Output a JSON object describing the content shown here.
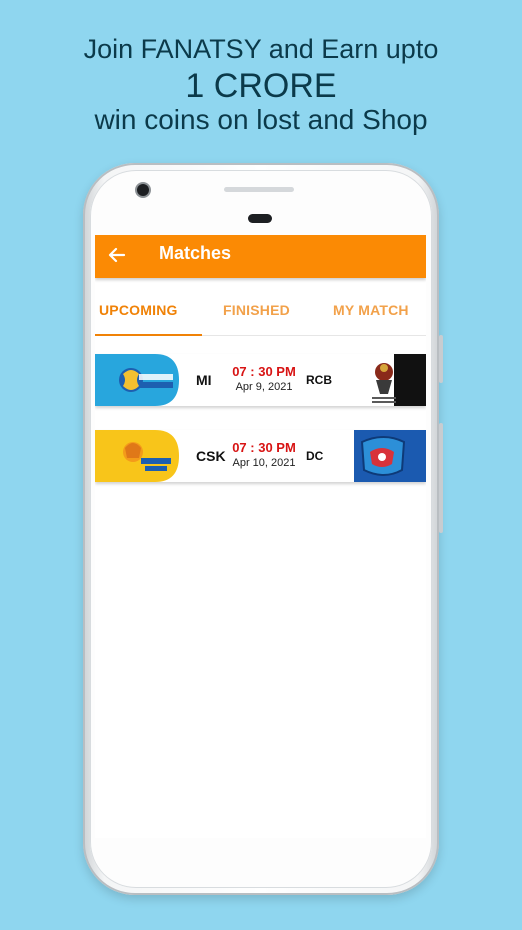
{
  "promo": {
    "line1": "Join FANATSY and Earn upto",
    "line2": "1 CRORE",
    "line3": "win coins on lost and Shop"
  },
  "app": {
    "title": "Matches",
    "tabs": [
      {
        "label": "UPCOMING",
        "active": true
      },
      {
        "label": "FINISHED",
        "active": false
      },
      {
        "label": "MY MATCH",
        "active": false
      }
    ],
    "matches": [
      {
        "team1": "MI",
        "team1_logo": "mumbai-indians-logo",
        "time": "07 : 30 PM",
        "date": "Apr 9, 2021",
        "team2": "RCB",
        "team2_logo": "royal-challengers-logo"
      },
      {
        "team1": "CSK",
        "team1_logo": "chennai-super-kings-logo",
        "time": "07 : 30 PM",
        "date": "Apr 10, 2021",
        "team2": "DC",
        "team2_logo": "delhi-capitals-logo"
      }
    ]
  },
  "colors": {
    "background": "#8fd6ef",
    "appbar": "#fb8a04",
    "tab_active": "#f08207",
    "time_text": "#d81414"
  }
}
